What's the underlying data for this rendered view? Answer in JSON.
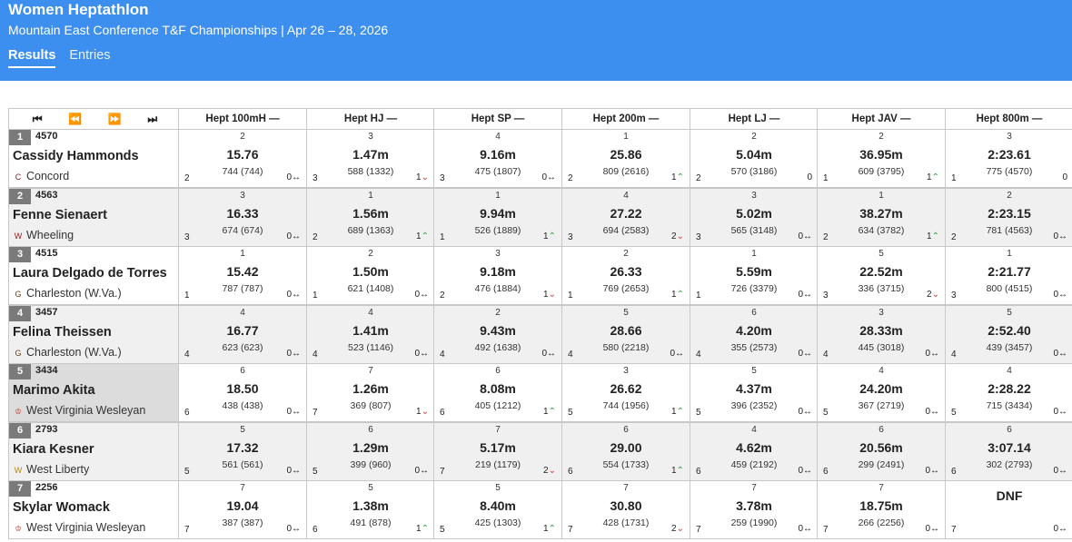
{
  "header": {
    "title": "Women Heptathlon",
    "subtitle": "Mountain East Conference T&F Championships | Apr 26 – 28, 2026",
    "tabs": [
      {
        "label": "Results",
        "active": true
      },
      {
        "label": "Entries",
        "active": false
      }
    ]
  },
  "nav": {
    "first": "⏮",
    "prev": "⏪",
    "next": "⏩",
    "last": "⏭"
  },
  "events": [
    "Hept 100mH —",
    "Hept HJ —",
    "Hept SP —",
    "Hept 200m —",
    "Hept LJ —",
    "Hept JAV —",
    "Hept 800m —"
  ],
  "athletes": [
    {
      "place": "1",
      "bib": "4570",
      "name": "Cassidy Hammonds",
      "team": "Concord",
      "logo": "C",
      "logo_color": "#8b1a1a",
      "results": [
        {
          "rank": "2",
          "mark": "15.76",
          "pts": "744 (744)",
          "oplace": "2",
          "move": "0",
          "dir": "same"
        },
        {
          "rank": "3",
          "mark": "1.47m",
          "pts": "588 (1332)",
          "oplace": "3",
          "move": "1",
          "dir": "down"
        },
        {
          "rank": "4",
          "mark": "9.16m",
          "pts": "475 (1807)",
          "oplace": "3",
          "move": "0",
          "dir": "same"
        },
        {
          "rank": "1",
          "mark": "25.86",
          "pts": "809 (2616)",
          "oplace": "2",
          "move": "1",
          "dir": "up"
        },
        {
          "rank": "2",
          "mark": "5.04m",
          "pts": "570 (3186)",
          "oplace": "2",
          "move": "0",
          "dir": "none"
        },
        {
          "rank": "2",
          "mark": "36.95m",
          "pts": "609 (3795)",
          "oplace": "1",
          "move": "1",
          "dir": "up"
        },
        {
          "rank": "3",
          "mark": "2:23.61",
          "pts": "775 (4570)",
          "oplace": "1",
          "move": "0",
          "dir": "none"
        }
      ]
    },
    {
      "place": "2",
      "bib": "4563",
      "name": "Fenne Sienaert",
      "team": "Wheeling",
      "logo": "W",
      "logo_color": "#a01818",
      "results": [
        {
          "rank": "3",
          "mark": "16.33",
          "pts": "674 (674)",
          "oplace": "3",
          "move": "0",
          "dir": "same"
        },
        {
          "rank": "1",
          "mark": "1.56m",
          "pts": "689 (1363)",
          "oplace": "2",
          "move": "1",
          "dir": "up"
        },
        {
          "rank": "1",
          "mark": "9.94m",
          "pts": "526 (1889)",
          "oplace": "1",
          "move": "1",
          "dir": "up"
        },
        {
          "rank": "4",
          "mark": "27.22",
          "pts": "694 (2583)",
          "oplace": "3",
          "move": "2",
          "dir": "down"
        },
        {
          "rank": "3",
          "mark": "5.02m",
          "pts": "565 (3148)",
          "oplace": "3",
          "move": "0",
          "dir": "same"
        },
        {
          "rank": "1",
          "mark": "38.27m",
          "pts": "634 (3782)",
          "oplace": "2",
          "move": "1",
          "dir": "up"
        },
        {
          "rank": "2",
          "mark": "2:23.15",
          "pts": "781 (4563)",
          "oplace": "2",
          "move": "0",
          "dir": "same"
        }
      ]
    },
    {
      "place": "3",
      "bib": "4515",
      "name": "Laura Delgado de Torres",
      "team": "Charleston (W.Va.)",
      "logo": "G",
      "logo_color": "#6b3f1a",
      "results": [
        {
          "rank": "1",
          "mark": "15.42",
          "pts": "787 (787)",
          "oplace": "1",
          "move": "0",
          "dir": "same"
        },
        {
          "rank": "2",
          "mark": "1.50m",
          "pts": "621 (1408)",
          "oplace": "1",
          "move": "0",
          "dir": "same"
        },
        {
          "rank": "3",
          "mark": "9.18m",
          "pts": "476 (1884)",
          "oplace": "2",
          "move": "1",
          "dir": "down"
        },
        {
          "rank": "2",
          "mark": "26.33",
          "pts": "769 (2653)",
          "oplace": "1",
          "move": "1",
          "dir": "up"
        },
        {
          "rank": "1",
          "mark": "5.59m",
          "pts": "726 (3379)",
          "oplace": "1",
          "move": "0",
          "dir": "same"
        },
        {
          "rank": "5",
          "mark": "22.52m",
          "pts": "336 (3715)",
          "oplace": "3",
          "move": "2",
          "dir": "down"
        },
        {
          "rank": "1",
          "mark": "2:21.77",
          "pts": "800 (4515)",
          "oplace": "3",
          "move": "0",
          "dir": "same"
        }
      ]
    },
    {
      "place": "4",
      "bib": "3457",
      "name": "Felina Theissen",
      "team": "Charleston (W.Va.)",
      "logo": "G",
      "logo_color": "#6b3f1a",
      "results": [
        {
          "rank": "4",
          "mark": "16.77",
          "pts": "623 (623)",
          "oplace": "4",
          "move": "0",
          "dir": "same"
        },
        {
          "rank": "4",
          "mark": "1.41m",
          "pts": "523 (1146)",
          "oplace": "4",
          "move": "0",
          "dir": "same"
        },
        {
          "rank": "2",
          "mark": "9.43m",
          "pts": "492 (1638)",
          "oplace": "4",
          "move": "0",
          "dir": "same"
        },
        {
          "rank": "5",
          "mark": "28.66",
          "pts": "580 (2218)",
          "oplace": "4",
          "move": "0",
          "dir": "same"
        },
        {
          "rank": "6",
          "mark": "4.20m",
          "pts": "355 (2573)",
          "oplace": "4",
          "move": "0",
          "dir": "same"
        },
        {
          "rank": "3",
          "mark": "28.33m",
          "pts": "445 (3018)",
          "oplace": "4",
          "move": "0",
          "dir": "same"
        },
        {
          "rank": "5",
          "mark": "2:52.40",
          "pts": "439 (3457)",
          "oplace": "4",
          "move": "0",
          "dir": "same"
        }
      ]
    },
    {
      "place": "5",
      "bib": "3434",
      "name": "Marimo Akita",
      "team": "West Virginia Wesleyan",
      "logo": "♔",
      "logo_color": "#c0392b",
      "results": [
        {
          "rank": "6",
          "mark": "18.50",
          "pts": "438 (438)",
          "oplace": "6",
          "move": "0",
          "dir": "same"
        },
        {
          "rank": "7",
          "mark": "1.26m",
          "pts": "369 (807)",
          "oplace": "7",
          "move": "1",
          "dir": "down"
        },
        {
          "rank": "6",
          "mark": "8.08m",
          "pts": "405 (1212)",
          "oplace": "6",
          "move": "1",
          "dir": "up"
        },
        {
          "rank": "3",
          "mark": "26.62",
          "pts": "744 (1956)",
          "oplace": "5",
          "move": "1",
          "dir": "up"
        },
        {
          "rank": "5",
          "mark": "4.37m",
          "pts": "396 (2352)",
          "oplace": "5",
          "move": "0",
          "dir": "same"
        },
        {
          "rank": "4",
          "mark": "24.20m",
          "pts": "367 (2719)",
          "oplace": "5",
          "move": "0",
          "dir": "same"
        },
        {
          "rank": "4",
          "mark": "2:28.22",
          "pts": "715 (3434)",
          "oplace": "5",
          "move": "0",
          "dir": "same"
        }
      ]
    },
    {
      "place": "6",
      "bib": "2793",
      "name": "Kiara Kesner",
      "team": "West Liberty",
      "logo": "W",
      "logo_color": "#b8860b",
      "results": [
        {
          "rank": "5",
          "mark": "17.32",
          "pts": "561 (561)",
          "oplace": "5",
          "move": "0",
          "dir": "same"
        },
        {
          "rank": "6",
          "mark": "1.29m",
          "pts": "399 (960)",
          "oplace": "5",
          "move": "0",
          "dir": "same"
        },
        {
          "rank": "7",
          "mark": "5.17m",
          "pts": "219 (1179)",
          "oplace": "7",
          "move": "2",
          "dir": "down"
        },
        {
          "rank": "6",
          "mark": "29.00",
          "pts": "554 (1733)",
          "oplace": "6",
          "move": "1",
          "dir": "up"
        },
        {
          "rank": "4",
          "mark": "4.62m",
          "pts": "459 (2192)",
          "oplace": "6",
          "move": "0",
          "dir": "same"
        },
        {
          "rank": "6",
          "mark": "20.56m",
          "pts": "299 (2491)",
          "oplace": "6",
          "move": "0",
          "dir": "same"
        },
        {
          "rank": "6",
          "mark": "3:07.14",
          "pts": "302 (2793)",
          "oplace": "6",
          "move": "0",
          "dir": "same"
        }
      ]
    },
    {
      "place": "7",
      "bib": "2256",
      "name": "Skylar Womack",
      "team": "West Virginia Wesleyan",
      "logo": "♔",
      "logo_color": "#c0392b",
      "results": [
        {
          "rank": "7",
          "mark": "19.04",
          "pts": "387 (387)",
          "oplace": "7",
          "move": "0",
          "dir": "same"
        },
        {
          "rank": "5",
          "mark": "1.38m",
          "pts": "491 (878)",
          "oplace": "6",
          "move": "1",
          "dir": "up"
        },
        {
          "rank": "5",
          "mark": "8.40m",
          "pts": "425 (1303)",
          "oplace": "5",
          "move": "1",
          "dir": "up"
        },
        {
          "rank": "7",
          "mark": "30.80",
          "pts": "428 (1731)",
          "oplace": "7",
          "move": "2",
          "dir": "down"
        },
        {
          "rank": "7",
          "mark": "3.78m",
          "pts": "259 (1990)",
          "oplace": "7",
          "move": "0",
          "dir": "same"
        },
        {
          "rank": "7",
          "mark": "18.75m",
          "pts": "266 (2256)",
          "oplace": "7",
          "move": "0",
          "dir": "same"
        },
        {
          "rank": "",
          "mark": "DNF",
          "pts": "",
          "oplace": "7",
          "move": "0",
          "dir": "same"
        }
      ]
    }
  ],
  "colors": {
    "header_bg": "#3d8fef",
    "place_badge": "#7a7a7a",
    "up": "#2e9e3e",
    "down": "#d23a3a"
  }
}
